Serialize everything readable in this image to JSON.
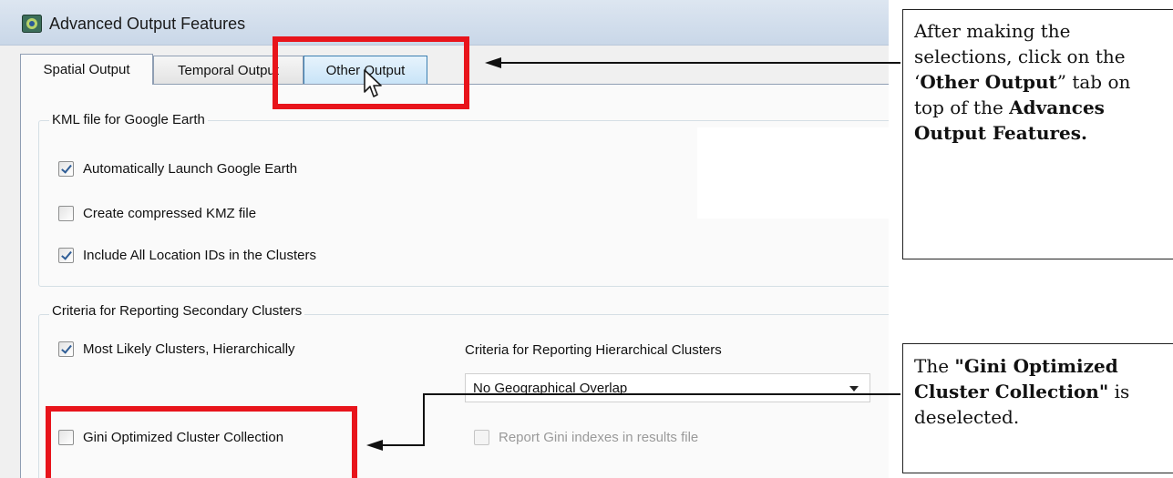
{
  "window": {
    "title": "Advanced Output Features",
    "icon": "satscan-app-icon"
  },
  "tabs": [
    {
      "label": "Spatial Output",
      "state": "selected"
    },
    {
      "label": "Temporal Output",
      "state": "normal"
    },
    {
      "label": "Other Output",
      "state": "hover"
    }
  ],
  "kml_group": {
    "legend": "KML file for Google Earth",
    "options": [
      {
        "label": "Automatically Launch Google Earth",
        "checked": true
      },
      {
        "label": "Create compressed KMZ file",
        "checked": false
      },
      {
        "label": "Include All Location IDs in the Clusters",
        "checked": true
      }
    ]
  },
  "criteria_group": {
    "legend": "Criteria for Reporting Secondary Clusters",
    "most_likely": {
      "label": "Most Likely Clusters, Hierarchically",
      "checked": true
    },
    "hierarchical_label": "Criteria for Reporting Hierarchical Clusters",
    "hierarchical_select": {
      "value": "No Geographical Overlap"
    },
    "gini": {
      "label": "Gini Optimized Cluster Collection",
      "checked": false
    },
    "report_gini": {
      "label": "Report Gini indexes in results file",
      "checked": false,
      "disabled": true
    }
  },
  "callouts": {
    "first": {
      "part1": "After making the selections, click on the ‘",
      "bold1": "Other Output",
      "part2": "” tab on top of the ",
      "bold2": "Advances Output Features."
    },
    "second": {
      "part1": "The ",
      "bold1": "\"Gini Optimized Cluster Collection\"",
      "part2": " is deselected."
    }
  },
  "colors": {
    "highlight_box": "#e8141b",
    "selected_tab_bg": "#fafafa",
    "hover_tab_bg": "#c9e4f8",
    "check_mark": "#2f5d96"
  }
}
